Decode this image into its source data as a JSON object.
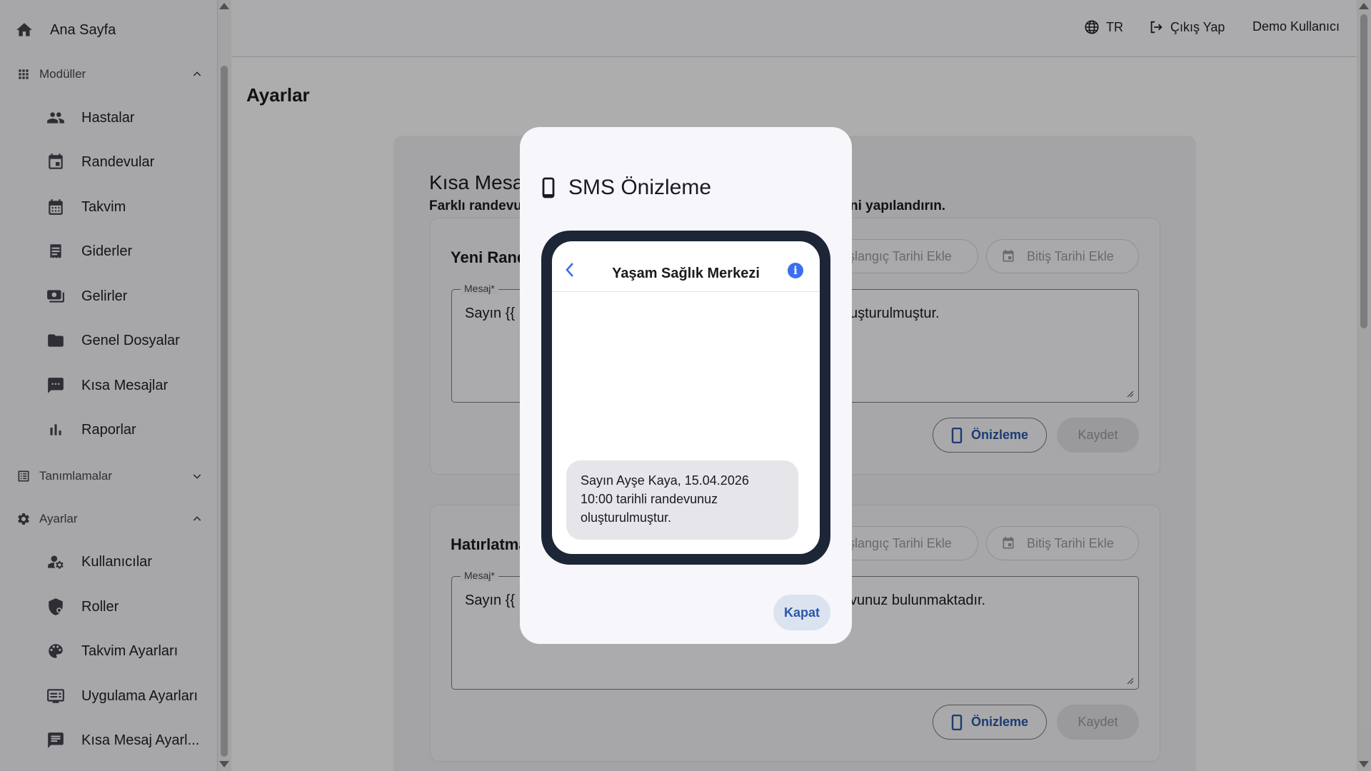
{
  "sidebar": {
    "home": "Ana Sayfa",
    "modules_group": "Modüller",
    "modules": [
      {
        "label": "Hastalar",
        "icon": "people-icon"
      },
      {
        "label": "Randevular",
        "icon": "calendar-event-icon"
      },
      {
        "label": "Takvim",
        "icon": "calendar-month-icon"
      },
      {
        "label": "Giderler",
        "icon": "receipt-icon"
      },
      {
        "label": "Gelirler",
        "icon": "payments-icon"
      },
      {
        "label": "Genel Dosyalar",
        "icon": "folder-icon"
      },
      {
        "label": "Kısa Mesajlar",
        "icon": "sms-icon"
      },
      {
        "label": "Raporlar",
        "icon": "bar-chart-icon"
      }
    ],
    "definitions_group": "Tanımlamalar",
    "settings_group": "Ayarlar",
    "settings": [
      {
        "label": "Kullanıcılar",
        "icon": "manage-accounts-icon"
      },
      {
        "label": "Roller",
        "icon": "shield-icon"
      },
      {
        "label": "Takvim Ayarları",
        "icon": "palette-icon"
      },
      {
        "label": "Uygulama Ayarları",
        "icon": "app-settings-icon"
      },
      {
        "label": "Kısa Mesaj Ayarl...",
        "icon": "message-settings-icon"
      }
    ]
  },
  "header": {
    "language": "TR",
    "logout": "Çıkış Yap",
    "user": "Demo Kullanıcı"
  },
  "page": {
    "title": "Ayarlar",
    "section_title": "Kısa Mesa",
    "section_desc_left": "Farklı randevu",
    "section_desc_right": "ni yapılandırın.",
    "blocks": [
      {
        "title": "Yeni Rand",
        "start_chip": "şlangıç Tarihi Ekle",
        "end_chip": "Bitiş Tarihi Ekle",
        "message_label": "Mesaj*",
        "message_left": "Sayın {{",
        "message_right": "uşturulmuştur.",
        "preview": "Önizleme",
        "save": "Kaydet"
      },
      {
        "title": "Hatırlatma",
        "start_chip": "şlangıç Tarihi Ekle",
        "end_chip": "Bitiş Tarihi Ekle",
        "message_label": "Mesaj*",
        "message_left": "Sayın {{",
        "message_right": "vunuz bulunmaktadır.",
        "preview": "Önizleme",
        "save": "Kaydet"
      }
    ]
  },
  "dialog": {
    "title": "SMS Önizleme",
    "sender": "Yaşam Sağlık Merkezi",
    "message": "Sayın Ayşe Kaya, 15.04.2026 10:00 tarihli randevunuz oluşturulmuştur.",
    "close": "Kapat"
  },
  "colors": {
    "accent": "#2b57a8",
    "phone_frame": "#1c2637",
    "ios_blue": "#3a6ff0"
  }
}
